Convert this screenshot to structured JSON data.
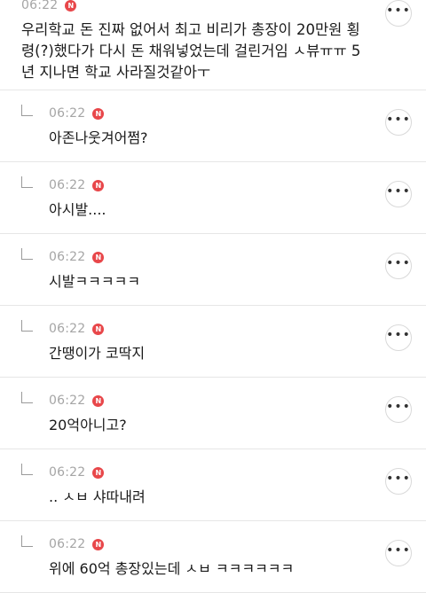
{
  "main_post": {
    "time": "06:22",
    "text": "우리학교 돈 진짜 없어서 최고 비리가 총장이 20만원 횡령(?)했다가 다시 돈 채워넣었는데 걸린거임 ㅅ뷰ㅠㅠ 5년 지나면 학교 사라질것같아ㅜ"
  },
  "new_badge": "N",
  "more_glyph": "•••",
  "replies": [
    {
      "time": "06:22",
      "text": "아존나웃겨어쩜?"
    },
    {
      "time": "06:22",
      "text": "아시발...."
    },
    {
      "time": "06:22",
      "text": "시발ㅋㅋㅋㅋㅋ"
    },
    {
      "time": "06:22",
      "text": "간땡이가 코딱지"
    },
    {
      "time": "06:22",
      "text": "20억아니고?"
    },
    {
      "time": "06:22",
      "text": ".. ㅅㅂ 샤따내려"
    },
    {
      "time": "06:22",
      "text": "위에 60억 총장있는데 ㅅㅂ ㅋㅋㅋㅋㅋㅋ"
    }
  ]
}
